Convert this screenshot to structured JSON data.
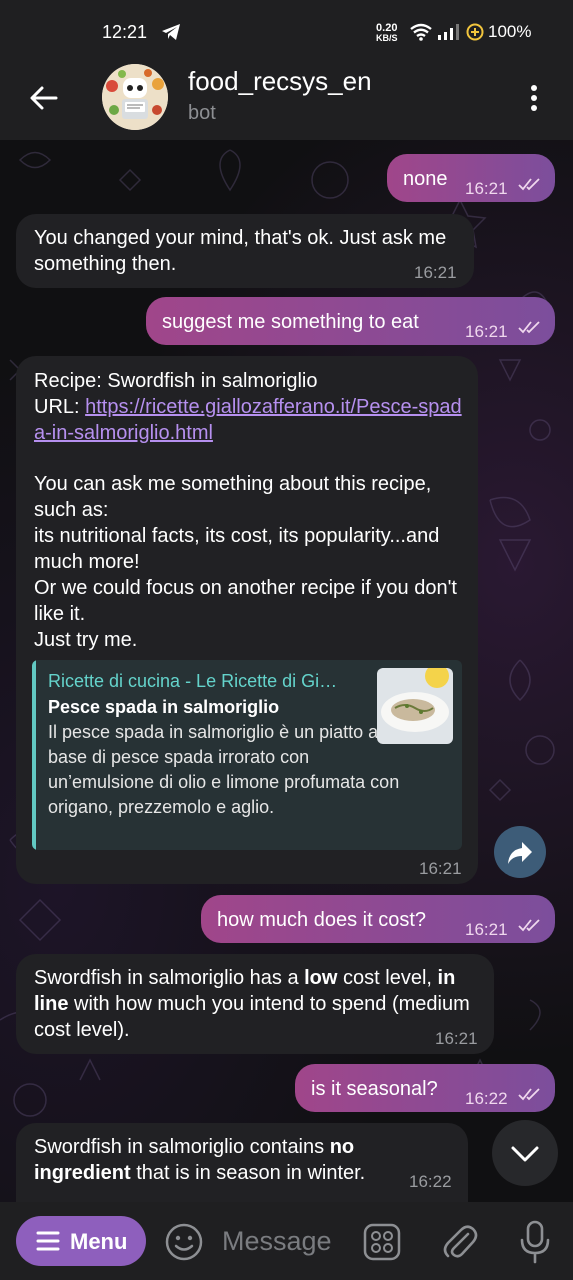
{
  "status_bar": {
    "time": "12:21",
    "net_speed_value": "0.20",
    "net_speed_unit": "KB/S",
    "battery": "100%"
  },
  "header": {
    "title": "food_recsys_en",
    "subtitle": "bot"
  },
  "messages": [
    {
      "dir": "out",
      "text": "none",
      "time": "16:21"
    },
    {
      "dir": "in",
      "text": "You changed your mind, that's ok. Just ask me something then.",
      "time": "16:21"
    },
    {
      "dir": "out",
      "text": "suggest me something to eat",
      "time": "16:21"
    },
    {
      "dir": "in",
      "recipe_line": "Recipe: Swordfish in salmoriglio",
      "url_label": "URL: ",
      "url": "https://ricette.giallozafferano.it/Pesce-spada-in-salmoriglio.html",
      "body": "You can ask me something about this recipe, such as:\nits nutritional facts, its cost, its popularity...and much more!\nOr we could focus on another recipe if you don't like it.\nJust try me.",
      "preview": {
        "site": "Ricette di cucina - Le Ricette di GialloZafferano",
        "title": "Pesce spada in salmoriglio",
        "description": "Il pesce spada in salmoriglio è un piatto a base di pesce spada irrorato con un’emulsione di olio e limone profumata con origano, prezzemolo e aglio."
      },
      "time": "16:21"
    },
    {
      "dir": "out",
      "text": "how much does it cost?",
      "time": "16:21"
    },
    {
      "dir": "in",
      "segments": [
        {
          "t": "Swordfish in salmoriglio has a ",
          "b": false
        },
        {
          "t": "low",
          "b": true
        },
        {
          "t": " cost level, ",
          "b": false
        },
        {
          "t": "in line",
          "b": true
        },
        {
          "t": " with how much you intend to spend (medium cost level).",
          "b": false
        }
      ],
      "time": "16:21"
    },
    {
      "dir": "out",
      "text": "is it seasonal?",
      "time": "16:22"
    },
    {
      "dir": "in",
      "segments": [
        {
          "t": "Swordfish in salmoriglio contains ",
          "b": false
        },
        {
          "t": "no ingredient",
          "b": true
        },
        {
          "t": " that is in season in winter.",
          "b": false
        }
      ],
      "time": "16:22"
    }
  ],
  "composer": {
    "menu_label": "Menu",
    "placeholder": "Message"
  },
  "colors": {
    "outgoing_bubble_start": "#a0468a",
    "outgoing_bubble_end": "#7c4e9c",
    "incoming_bubble": "#212124",
    "link": "#b690ef",
    "preview_accent": "#62c8c2",
    "menu_button": "#8e5fbd"
  },
  "icons": [
    "back-arrow-icon",
    "more-vertical-icon",
    "share-icon",
    "chevron-down-icon",
    "emoji-icon",
    "command-grid-icon",
    "paperclip-icon",
    "microphone-icon",
    "telegram-icon",
    "wifi-icon",
    "signal-icon",
    "battery-saver-icon",
    "double-check-icon"
  ]
}
